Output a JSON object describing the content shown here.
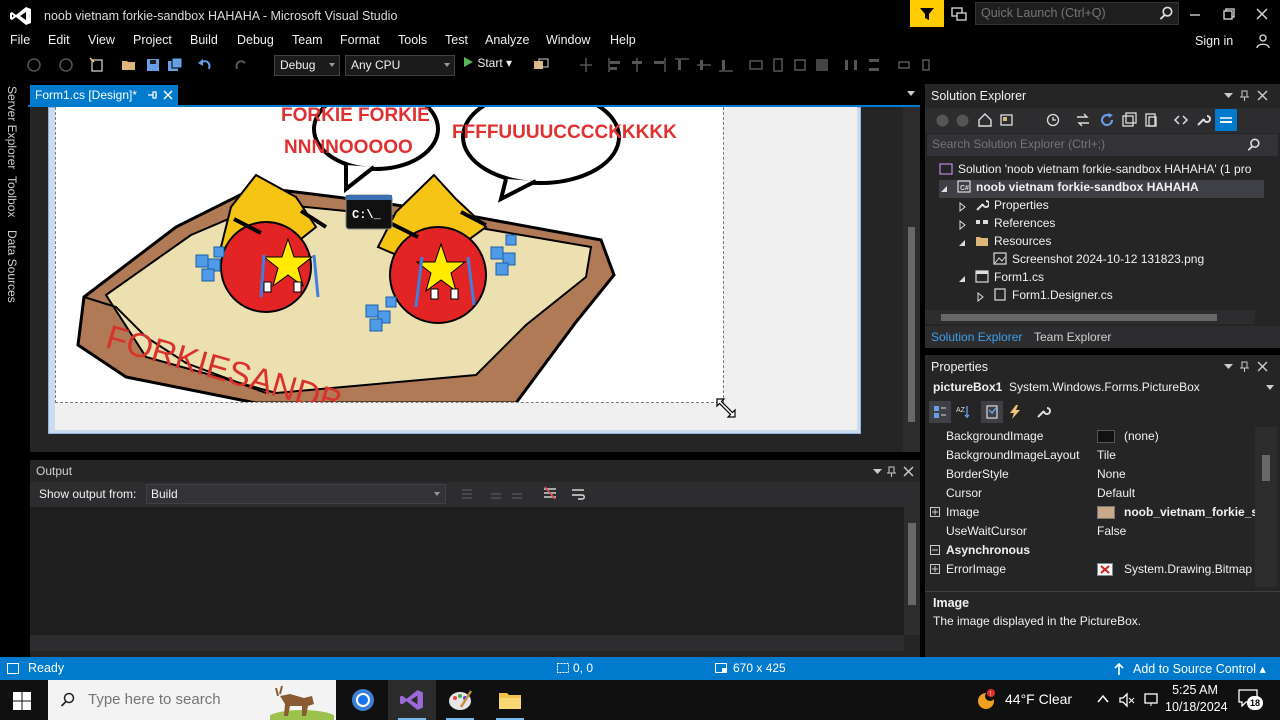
{
  "window": {
    "title": "noob vietnam forkie-sandbox HAHAHA - Microsoft Visual Studio",
    "quick_launch_placeholder": "Quick Launch (Ctrl+Q)",
    "sign_in": "Sign in"
  },
  "menu": [
    "File",
    "Edit",
    "View",
    "Project",
    "Build",
    "Debug",
    "Team",
    "Format",
    "Tools",
    "Test",
    "Analyze",
    "Window",
    "Help"
  ],
  "toolbar": {
    "config": "Debug",
    "platform": "Any CPU",
    "start": "Start"
  },
  "left_rail": [
    "Server Explorer",
    "Toolbox",
    "Data Sources"
  ],
  "document_tab": {
    "label": "Form1.cs [Design]*"
  },
  "picture": {
    "text_left_1": "FORKIE FORKIE",
    "text_left_2": "NNNNOOOOO",
    "text_right": "FFFFUUUUCCCCKKKKK",
    "box_text": "FORKIESANDB",
    "cmd_label": "C:\\_"
  },
  "output": {
    "title": "Output",
    "show_label": "Show output from:",
    "source": "Build"
  },
  "solution_explorer": {
    "title": "Solution Explorer",
    "search_placeholder": "Search Solution Explorer (Ctrl+;)",
    "items": [
      "Solution 'noob vietnam forkie-sandbox HAHAHA' (1 pro",
      "noob vietnam forkie-sandbox HAHAHA",
      "Properties",
      "References",
      "Resources",
      "Screenshot 2024-10-12 131823.png",
      "Form1.cs",
      "Form1.Designer.cs"
    ],
    "tabs": [
      "Solution Explorer",
      "Team Explorer"
    ]
  },
  "properties": {
    "title": "Properties",
    "object_name": "pictureBox1",
    "object_type": "System.Windows.Forms.PictureBox",
    "rows": [
      {
        "name": "BackgroundImage",
        "value": "(none)"
      },
      {
        "name": "BackgroundImageLayout",
        "value": "Tile"
      },
      {
        "name": "BorderStyle",
        "value": "None"
      },
      {
        "name": "Cursor",
        "value": "Default"
      },
      {
        "name": "Image",
        "value": "noob_vietnam_forkie_sa"
      },
      {
        "name": "UseWaitCursor",
        "value": "False"
      },
      {
        "name": "Asynchronous",
        "value": ""
      },
      {
        "name": "ErrorImage",
        "value": "System.Drawing.Bitmap"
      }
    ],
    "desc_title": "Image",
    "desc_text": "The image displayed in the PictureBox."
  },
  "status": {
    "ready": "Ready",
    "position": "0, 0",
    "size": "670 x 425",
    "source_control": "Add to Source Control"
  },
  "taskbar": {
    "search_placeholder": "Type here to search",
    "temperature": "44°F  Clear",
    "time": "5:25 AM",
    "date": "10/18/2024",
    "notification_count": "18"
  },
  "colors": {
    "accent": "#007acc",
    "dark_bg": "#252526",
    "quick_launch_filter": "#ffcc00"
  }
}
